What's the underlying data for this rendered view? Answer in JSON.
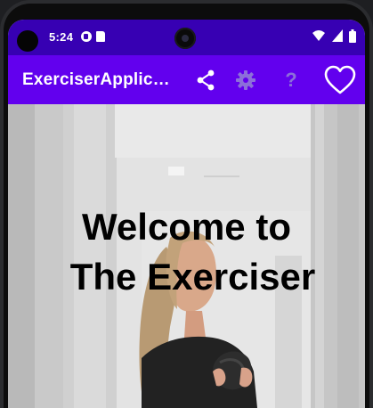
{
  "status_bar": {
    "time": "5:24",
    "icons": [
      "notification-icon",
      "sd-card-icon",
      "wifi-icon",
      "signal-icon",
      "battery-icon"
    ]
  },
  "app_bar": {
    "title": "ExerciserApplicat…",
    "actions": [
      "share-icon",
      "settings-icon",
      "help-icon",
      "favorite-icon"
    ],
    "help_glyph": "?"
  },
  "hero": {
    "line1": "Welcome to",
    "line2": "The Exerciser"
  },
  "colors": {
    "status_bar": "#3700b3",
    "app_bar": "#6200ee",
    "icon_dim": "#8c6fd9"
  }
}
